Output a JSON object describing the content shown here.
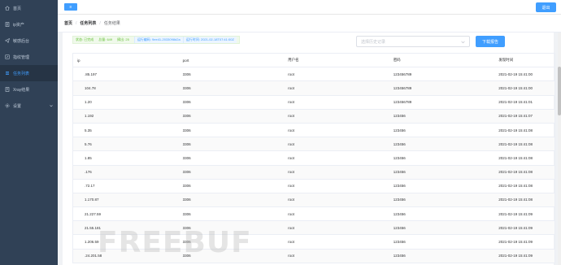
{
  "sidebar": {
    "items": [
      {
        "label": "首页",
        "icon": "home-icon",
        "active": false
      },
      {
        "label": "ip资产",
        "icon": "document-icon",
        "active": false
      },
      {
        "label": "敏感后台",
        "icon": "send-icon",
        "active": false
      },
      {
        "label": "指纹管理",
        "icon": "edit-icon",
        "active": false
      },
      {
        "label": "任务列表",
        "icon": "list-icon",
        "active": true
      },
      {
        "label": "Xray结果",
        "icon": "document-icon",
        "active": false
      },
      {
        "label": "设置",
        "icon": "gear-icon",
        "active": false
      }
    ]
  },
  "header": {
    "menu_icon": "≡",
    "logout_label": "退出"
  },
  "breadcrumb": {
    "home": "首页",
    "tasks": "任务列表",
    "result": "任务结果",
    "separator": "/"
  },
  "status": {
    "state": "状态: 已完成",
    "total": "总量: 649",
    "found": "摘出: 25",
    "run_id": "运行编码: 9ee41-2033098d2a",
    "run_time": "运行时间: 2021-02-18T07:41:00Z"
  },
  "controls": {
    "history_placeholder": "选择历史记录",
    "download_label": "下载报告"
  },
  "table": {
    "headers": [
      "ip",
      "port",
      "用户名",
      "密码",
      "发现时间"
    ],
    "rows": [
      {
        "ip": ".85.197",
        "port": "3306",
        "user": "root",
        "password": "123456789",
        "time": "2021-02-19 15:41:00"
      },
      {
        "ip": "104.78",
        "port": "3306",
        "user": "root",
        "password": "123456789",
        "time": "2021-02-19 15:41:00"
      },
      {
        "ip": "1.20",
        "port": "3306",
        "user": "root",
        "password": "123456789",
        "time": "2021-02-19 15:41:01"
      },
      {
        "ip": "1.192",
        "port": "3306",
        "user": "root",
        "password": "123456",
        "time": "2021-02-19 15:41:07"
      },
      {
        "ip": "5.35",
        "port": "3306",
        "user": "root",
        "password": "123456",
        "time": "2021-02-19 15:41:08"
      },
      {
        "ip": "5.76",
        "port": "3306",
        "user": "root",
        "password": "123456",
        "time": "2021-02-19 15:41:08"
      },
      {
        "ip": "1.85",
        "port": "3306",
        "user": "root",
        "password": "123456",
        "time": "2021-02-19 15:41:08"
      },
      {
        "ip": ".176",
        "port": "3306",
        "user": "root",
        "password": "123456",
        "time": "2021-02-19 15:41:08"
      },
      {
        "ip": ".72.17",
        "port": "3306",
        "user": "root",
        "password": "123456",
        "time": "2021-02-19 15:41:08"
      },
      {
        "ip": "1.170.87",
        "port": "3306",
        "user": "root",
        "password": "123456",
        "time": "2021-02-19 15:41:08"
      },
      {
        "ip": "21.227.59",
        "port": "3306",
        "user": "root",
        "password": "123456",
        "time": "2021-02-19 15:41:09"
      },
      {
        "ip": "21.55.181",
        "port": "3306",
        "user": "root",
        "password": "123456",
        "time": "2021-02-19 15:41:09"
      },
      {
        "ip": "1.206.59",
        "port": "3306",
        "user": "root",
        "password": "123456",
        "time": "2021-02-19 15:41:09"
      },
      {
        "ip": ".24.201.58",
        "port": "3306",
        "user": "root",
        "password": "123456",
        "time": "2021-02-19 15:41:09"
      }
    ]
  },
  "watermark": {
    "text": "FREEBUF"
  },
  "colors": {
    "sidebar_bg": "#304156",
    "sidebar_text": "#bfcbd9",
    "active": "#409eff",
    "success": "#67c23a"
  }
}
